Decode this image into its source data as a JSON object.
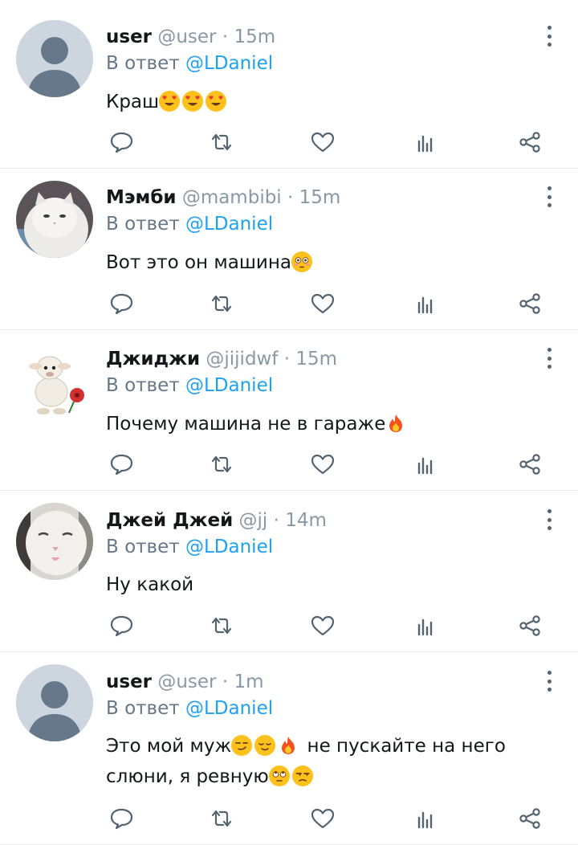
{
  "reply_prefix": "В ответ",
  "tweets": [
    {
      "name": "user",
      "handle": "@user",
      "sep": "·",
      "time": "15m",
      "reply_to": "@LDaniel",
      "avatar": "default-avatar",
      "text_lines": [
        "Краш"
      ],
      "emojis": [
        "heart-eyes-emoji",
        "heart-eyes-emoji",
        "heart-eyes-emoji"
      ]
    },
    {
      "name": "Мэмби",
      "handle": "@mambibi",
      "sep": "·",
      "time": "15m",
      "reply_to": "@LDaniel",
      "avatar": "white-cat-photo",
      "text_lines": [
        "Вот это он машина"
      ],
      "emojis": [
        "flushed-emoji"
      ]
    },
    {
      "name": "Джиджи",
      "handle": "@jijidwf",
      "sep": "·",
      "time": "15m",
      "reply_to": "@LDaniel",
      "avatar": "cartoon-lamb-with-flower",
      "text_lines": [
        "Почему машина не в гараже"
      ],
      "emojis": [
        "fire-emoji"
      ]
    },
    {
      "name": "Джей Джей",
      "handle": "@jj",
      "sep": "·",
      "time": "14m",
      "reply_to": "@LDaniel",
      "avatar": "kitten-face-photo",
      "text_lines": [
        "Ну какой"
      ],
      "emojis": []
    },
    {
      "name": "user",
      "handle": "@user",
      "sep": "·",
      "time": "1m",
      "reply_to": "@LDaniel",
      "avatar": "default-avatar",
      "text_lines": [
        "Это мой муж",
        " не пускайте на него",
        "слюни, я ревную"
      ],
      "emojis": [
        "smirk-emoji",
        "relieved-emoji",
        "fire-emoji",
        "eye-roll-emoji",
        "unamused-emoji"
      ]
    }
  ],
  "actions": [
    "reply-icon",
    "retweet-icon",
    "like-icon",
    "analytics-icon",
    "share-icon"
  ],
  "colors": {
    "accent": "#1da1f2",
    "muted": "#657786",
    "icon": "#536471",
    "divider": "#e6ecf0"
  }
}
